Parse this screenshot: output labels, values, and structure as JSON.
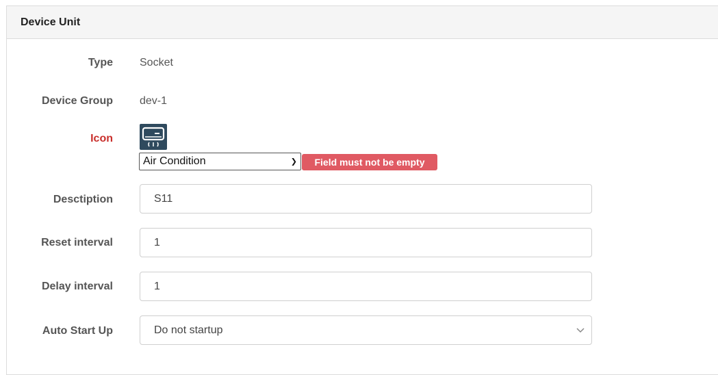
{
  "panel": {
    "title": "Device Unit"
  },
  "fields": {
    "type": {
      "label": "Type",
      "value": "Socket"
    },
    "device_group": {
      "label": "Device Group",
      "value": "dev-1"
    },
    "icon": {
      "label": "Icon",
      "label_color": "#c9302c",
      "icon_name": "air-conditioner-icon",
      "selected": "Air Condition",
      "error": "Field must not be empty",
      "error_color": "#e05a63"
    },
    "description": {
      "label": "Desctiption",
      "value": "S11"
    },
    "reset_interval": {
      "label": "Reset interval",
      "value": "1"
    },
    "delay_interval": {
      "label": "Delay interval",
      "value": "1"
    },
    "auto_start_up": {
      "label": "Auto Start Up",
      "selected": "Do not startup"
    }
  }
}
